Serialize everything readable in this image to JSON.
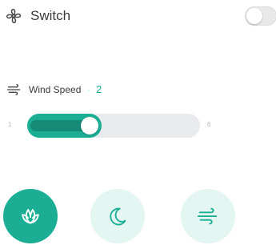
{
  "switch": {
    "label": "Switch",
    "on": false
  },
  "wind_speed": {
    "label": "Wind Speed",
    "separator": "·",
    "value": "2",
    "min": "1",
    "max": "6",
    "level": 2
  },
  "modes": [
    {
      "name": "eco",
      "icon": "leaf-icon",
      "active": true
    },
    {
      "name": "sleep",
      "icon": "moon-icon",
      "active": false
    },
    {
      "name": "wind",
      "icon": "wind-icon",
      "active": false
    }
  ],
  "colors": {
    "accent": "#1cae95",
    "accent_light": "#e3f6f2",
    "track": "#e9eaed",
    "text": "#3a3a3a"
  }
}
